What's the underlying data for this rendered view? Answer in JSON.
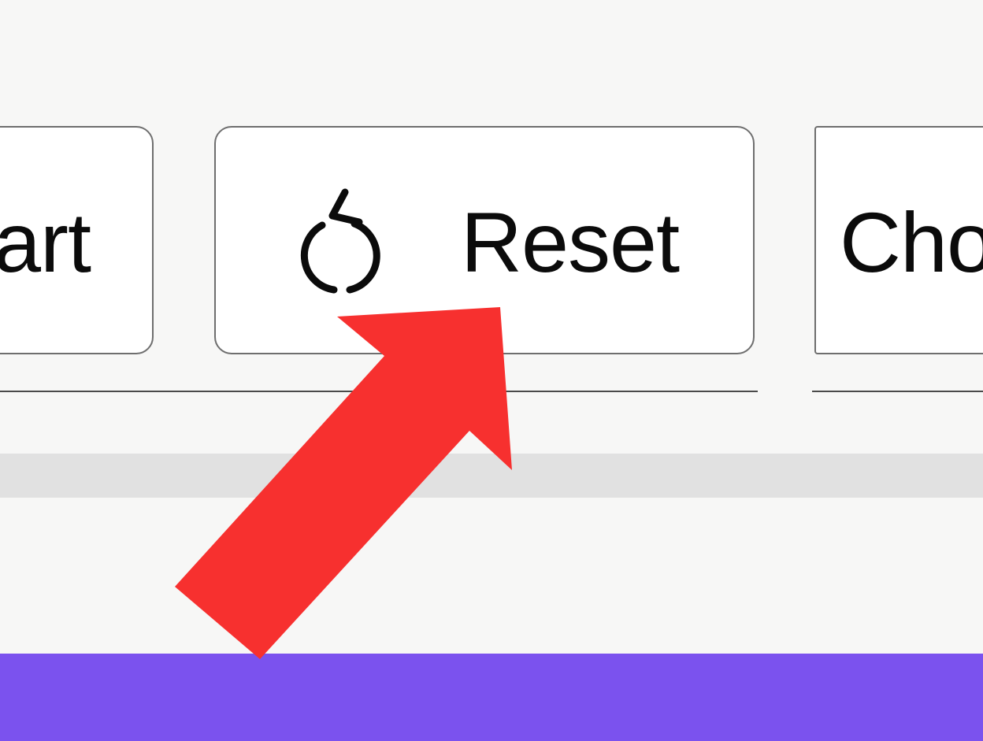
{
  "toolbar": {
    "start_label": "art",
    "reset_label": "Reset",
    "reset_icon": "reset-icon",
    "choose_label": "Cho"
  },
  "annotation": {
    "arrow_icon": "pointer-arrow-icon",
    "arrow_color": "#f7302f"
  },
  "colors": {
    "background": "#f7f7f6",
    "bottom_bar": "#7b52ee",
    "scroll_track": "#e1e1e1"
  }
}
